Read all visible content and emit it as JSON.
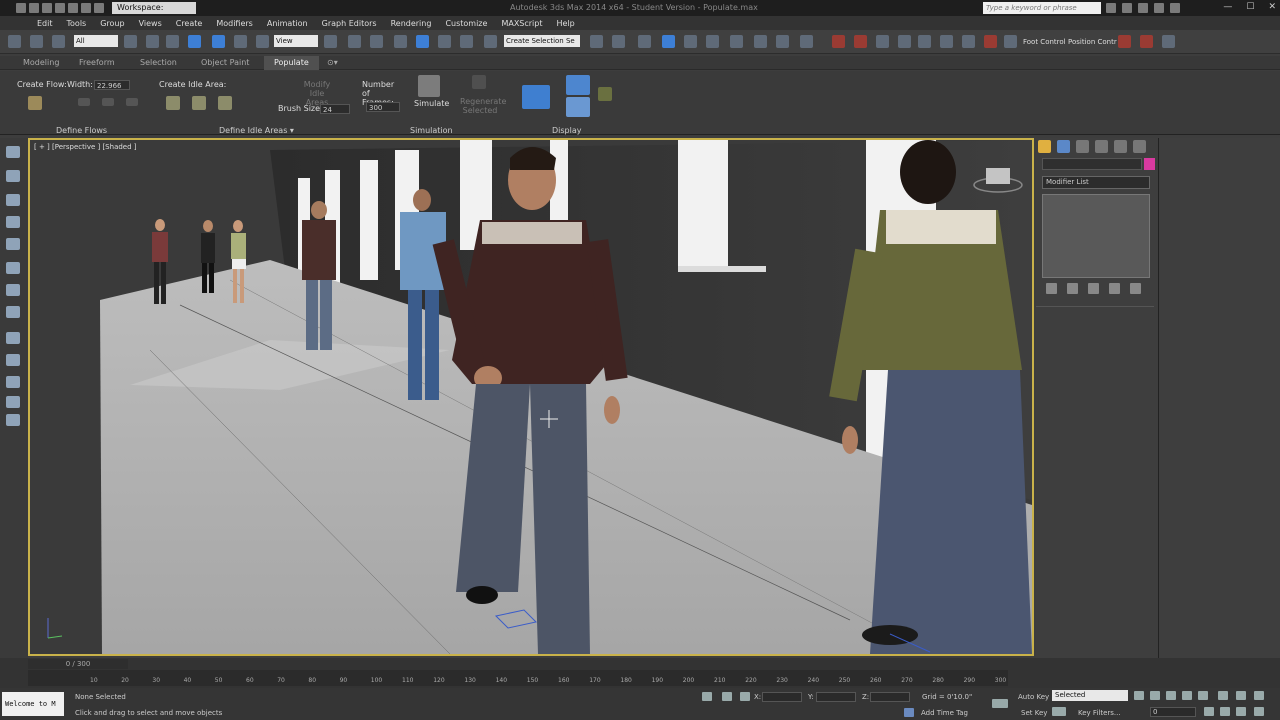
{
  "titlebar": {
    "workspace": "Workspace: Default",
    "title": "Autodesk 3ds Max 2014 x64 - Student Version - Populate.max",
    "search_placeholder": "Type a keyword or phrase",
    "minimize": "—",
    "maximize": "☐",
    "close": "✕"
  },
  "menu": {
    "items": [
      "Edit",
      "Tools",
      "Group",
      "Views",
      "Create",
      "Modifiers",
      "Animation",
      "Graph Editors",
      "Rendering",
      "Customize",
      "MAXScript",
      "Help"
    ]
  },
  "toolbar": {
    "selection_filter": "All",
    "reference_coord": "View",
    "named_selection": "Create Selection Se",
    "foot_control": "Foot Control",
    "position_control": "Position Contr"
  },
  "ribbon": {
    "tabs": [
      "Modeling",
      "Freeform",
      "Selection",
      "Object Paint",
      "Populate"
    ],
    "active_tab": "Populate",
    "create_flow": "Create Flow:",
    "width_label": "Width:",
    "width_value": "22.966",
    "create_idle_area": "Create Idle Area:",
    "modify_idle_areas": "Modify Idle Areas",
    "brush_size_label": "Brush Size:",
    "brush_size_value": "24",
    "frames_label": "Number of Frames:",
    "frames_value": "300",
    "simulate": "Simulate",
    "regenerate": "Regenerate Selected",
    "groups": {
      "define_flows": "Define Flows",
      "define_idle_areas": "Define Idle Areas ▾",
      "simulation": "Simulation",
      "display": "Display"
    }
  },
  "viewport": {
    "label": "[ + ] [Perspective ] [Shaded ]"
  },
  "command_panel": {
    "modifier_list": "Modifier List"
  },
  "timeline": {
    "frame": "0 / 300",
    "ticks": [
      "10",
      "20",
      "30",
      "40",
      "50",
      "60",
      "70",
      "80",
      "90",
      "100",
      "110",
      "120",
      "130",
      "140",
      "150",
      "160",
      "170",
      "180",
      "190",
      "200",
      "210",
      "220",
      "230",
      "240",
      "250",
      "260",
      "270",
      "280",
      "290",
      "300"
    ]
  },
  "status": {
    "welcome": "Welcome to M",
    "selection": "None Selected",
    "prompt": "Click and drag to select and move objects",
    "x_label": "X:",
    "y_label": "Y:",
    "z_label": "Z:",
    "grid": "Grid = 0'10.0\"",
    "add_time_tag": "Add Time Tag",
    "auto_key": "Auto Key",
    "set_key": "Set Key",
    "key_mode": "Selected",
    "key_filters": "Key Filters...",
    "frame_value": "0"
  },
  "colors": {
    "viewport_border": "#c9b24a",
    "active_blue": "#3d7fd6",
    "object_color": "#d93aa0"
  }
}
